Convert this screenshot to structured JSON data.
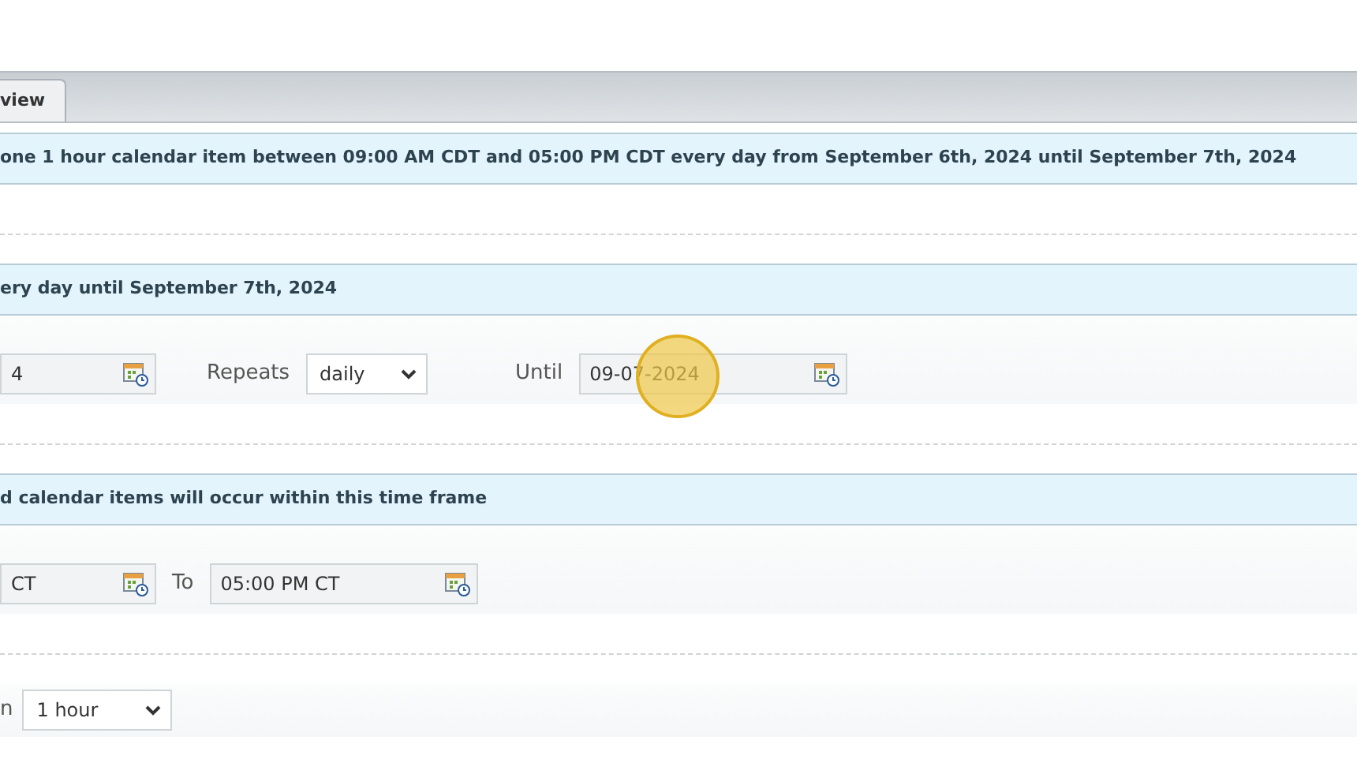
{
  "tabs": [
    {
      "label": "view",
      "selected": true
    }
  ],
  "sections": [
    {
      "banner": "one 1 hour calendar item between 09:00 AM CDT and 05:00 PM CDT every day from September 6th, 2024 until September 7th, 2024"
    },
    {
      "banner": "ery day until September 7th, 2024",
      "fields": [
        {
          "kind": "date",
          "value": "4"
        },
        {
          "kind": "label",
          "text": "Repeats"
        },
        {
          "kind": "select",
          "value": "daily"
        },
        {
          "kind": "label",
          "text": "Until"
        },
        {
          "kind": "date",
          "value": "09-07-2024"
        }
      ]
    },
    {
      "banner": "d calendar items will occur within this time frame",
      "fields": [
        {
          "kind": "date",
          "value": "CT"
        },
        {
          "kind": "label",
          "text": "To"
        },
        {
          "kind": "date",
          "value": "05:00 PM CT"
        }
      ]
    },
    {
      "fields": [
        {
          "kind": "label",
          "text": "n"
        },
        {
          "kind": "select",
          "value": "1 hour"
        }
      ]
    }
  ]
}
